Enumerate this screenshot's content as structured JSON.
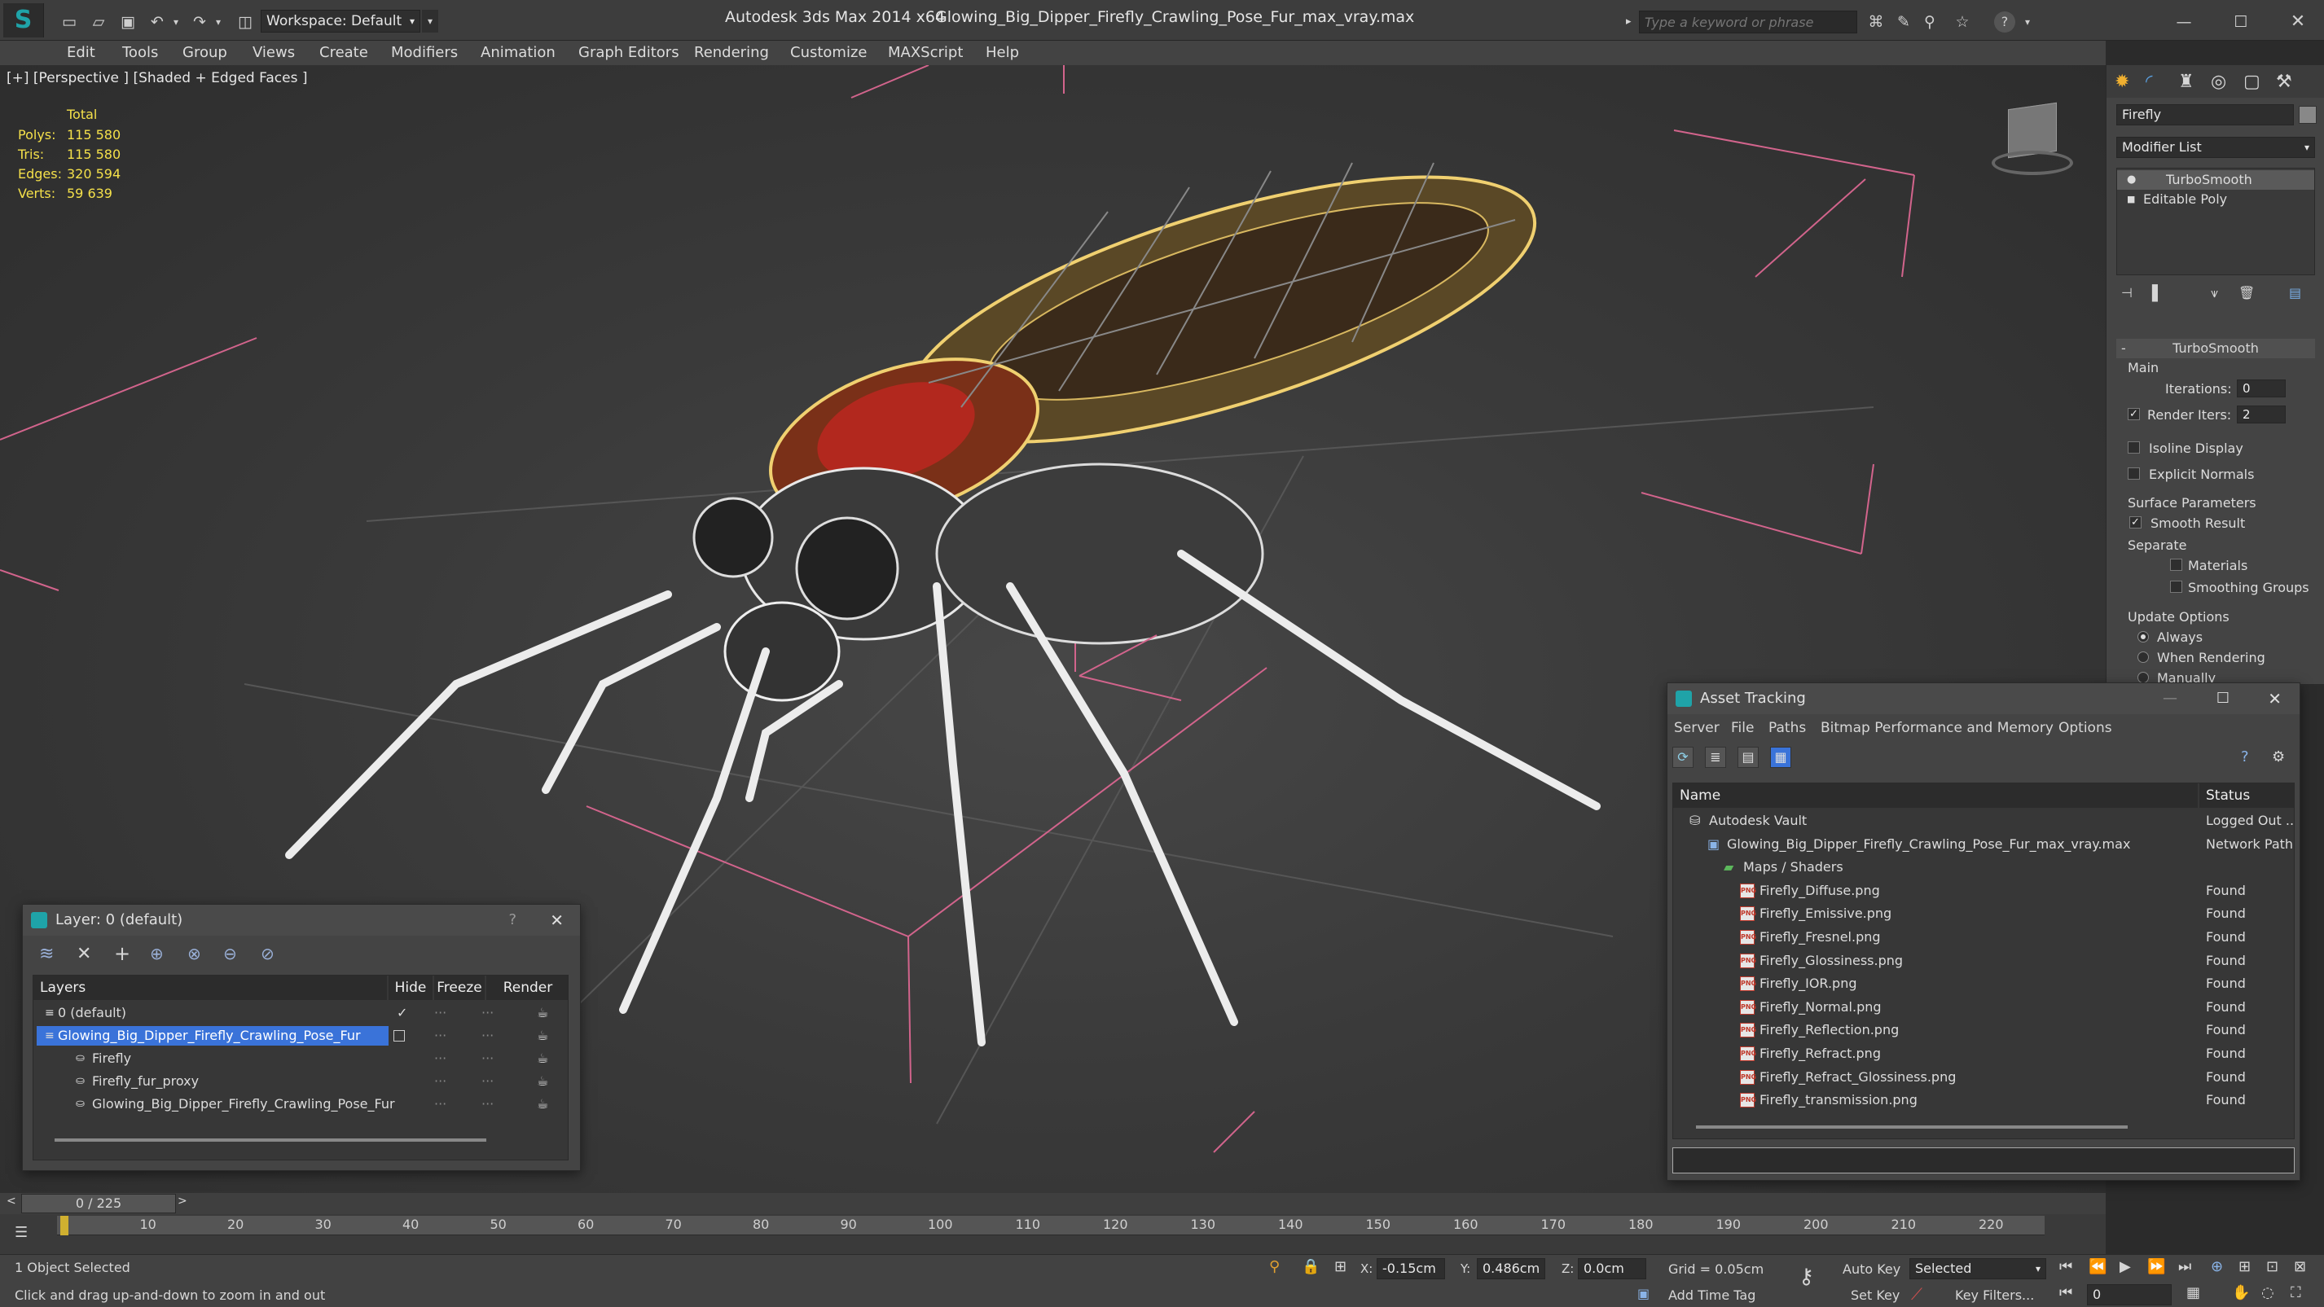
{
  "titlebar": {
    "workspace": "Workspace: Default",
    "app_title": "Autodesk 3ds Max  2014 x64",
    "file_title": "Glowing_Big_Dipper_Firefly_Crawling_Pose_Fur_max_vray.max",
    "search_placeholder": "Type a keyword or phrase"
  },
  "menu": [
    "Edit",
    "Tools",
    "Group",
    "Views",
    "Create",
    "Modifiers",
    "Animation",
    "Graph Editors",
    "Rendering",
    "Customize",
    "MAXScript",
    "Help"
  ],
  "viewport": {
    "label": "[+] [Perspective ] [Shaded + Edged Faces ]",
    "stats": {
      "header": "Total",
      "rows": [
        {
          "label": "Polys:",
          "value": "115 580"
        },
        {
          "label": "Tris:",
          "value": "115 580"
        },
        {
          "label": "Edges:",
          "value": "320 594"
        },
        {
          "label": "Verts:",
          "value": "59 639"
        }
      ]
    }
  },
  "command_panel": {
    "object_name": "Firefly",
    "modifier_list": "Modifier List",
    "stack": [
      "TurboSmooth",
      "Editable Poly"
    ],
    "rollout": "TurboSmooth",
    "main": "Main",
    "iterations_label": "Iterations:",
    "iterations": "0",
    "render_iters_label": "Render Iters:",
    "render_iters": "2",
    "isoline": "Isoline Display",
    "explicit_normals": "Explicit Normals",
    "surface_params": "Surface Parameters",
    "smooth_result": "Smooth Result",
    "separate": "Separate",
    "materials": "Materials",
    "smoothing_groups": "Smoothing Groups",
    "update_options": "Update Options",
    "always": "Always",
    "when_rendering": "When Rendering",
    "manually": "Manually"
  },
  "layer_window": {
    "title": "Layer: 0 (default)",
    "help": "?",
    "columns": [
      "Layers",
      "Hide",
      "Freeze",
      "Render"
    ],
    "rows": [
      {
        "name": "0 (default)",
        "level": 0
      },
      {
        "name": "Glowing_Big_Dipper_Firefly_Crawling_Pose_Fur",
        "level": 0
      },
      {
        "name": "Firefly",
        "level": 1
      },
      {
        "name": "Firefly_fur_proxy",
        "level": 1
      },
      {
        "name": "Glowing_Big_Dipper_Firefly_Crawling_Pose_Fur",
        "level": 1
      }
    ]
  },
  "asset_tracking": {
    "title": "Asset Tracking",
    "menu": [
      "Server",
      "File",
      "Paths",
      "Bitmap Performance and Memory",
      "Options"
    ],
    "columns": [
      "Name",
      "Status"
    ],
    "rows": [
      {
        "name": "Autodesk Vault",
        "status": "Logged Out ...",
        "level": 0
      },
      {
        "name": "Glowing_Big_Dipper_Firefly_Crawling_Pose_Fur_max_vray.max",
        "status": "Network Path",
        "level": 1
      },
      {
        "name": "Maps / Shaders",
        "status": "",
        "level": 2
      },
      {
        "name": "Firefly_Diffuse.png",
        "status": "Found",
        "level": 3
      },
      {
        "name": "Firefly_Emissive.png",
        "status": "Found",
        "level": 3
      },
      {
        "name": "Firefly_Fresnel.png",
        "status": "Found",
        "level": 3
      },
      {
        "name": "Firefly_Glossiness.png",
        "status": "Found",
        "level": 3
      },
      {
        "name": "Firefly_IOR.png",
        "status": "Found",
        "level": 3
      },
      {
        "name": "Firefly_Normal.png",
        "status": "Found",
        "level": 3
      },
      {
        "name": "Firefly_Reflection.png",
        "status": "Found",
        "level": 3
      },
      {
        "name": "Firefly_Refract.png",
        "status": "Found",
        "level": 3
      },
      {
        "name": "Firefly_Refract_Glossiness.png",
        "status": "Found",
        "level": 3
      },
      {
        "name": "Firefly_transmission.png",
        "status": "Found",
        "level": 3
      }
    ]
  },
  "timeline": {
    "frame": "0 / 225",
    "ticks": [
      "10",
      "20",
      "30",
      "40",
      "50",
      "60",
      "70",
      "80",
      "90",
      "100",
      "110",
      "120",
      "130",
      "140",
      "150",
      "160",
      "170",
      "180",
      "190",
      "200",
      "210",
      "220"
    ]
  },
  "status": {
    "selected": "1 Object Selected",
    "prompt": "Click and drag up-and-down to zoom in and out",
    "x_label": "X:",
    "x": "-0.15cm",
    "y_label": "Y:",
    "y": "0.486cm",
    "z_label": "Z:",
    "z": "0.0cm",
    "grid": "Grid = 0.05cm",
    "auto_key": "Auto Key",
    "set_key": "Set Key",
    "selected_opt": "Selected",
    "key_filters": "Key Filters...",
    "add_time_tag": "Add Time Tag",
    "frame_field": "0"
  },
  "colors": {
    "stats": "#f4e04a",
    "selection": "#3a73d9",
    "grid_line": "#d2648c"
  }
}
